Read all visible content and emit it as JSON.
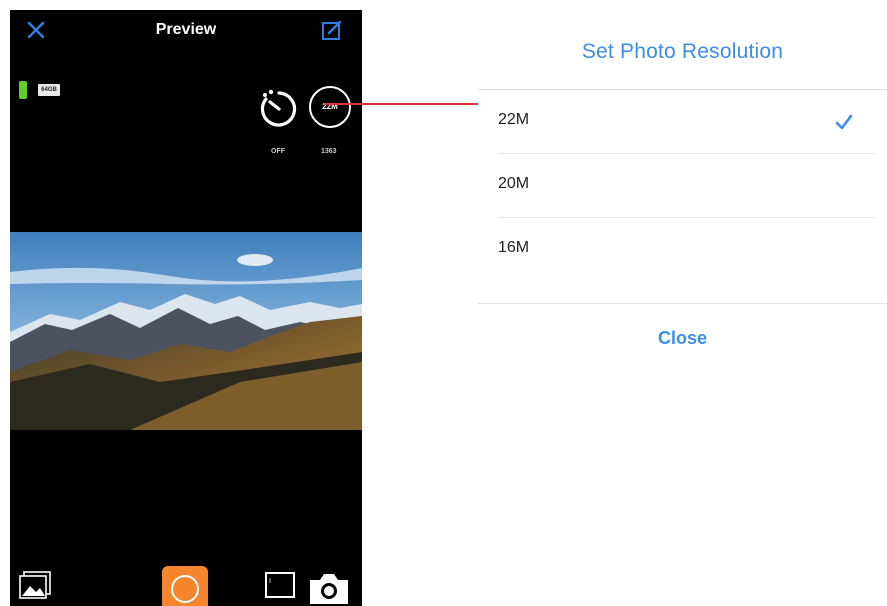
{
  "preview": {
    "title": "Preview",
    "storage_label": "64GB",
    "resolution_badge": "22M",
    "timer_label": "OFF",
    "remaining_count": "1363",
    "video_mode_label": "I"
  },
  "sheet": {
    "title": "Set Photo Resolution",
    "options": [
      {
        "label": "22M",
        "selected": true
      },
      {
        "label": "20M",
        "selected": false
      },
      {
        "label": "16M",
        "selected": false
      }
    ],
    "close_label": "Close"
  },
  "colors": {
    "accent": "#3a8ee6",
    "connector": "#e0343c",
    "shutter": "#f5862d",
    "battery": "#5ecf2d"
  },
  "icons": [
    "close-icon",
    "edit-icon",
    "battery-icon",
    "storage-icon",
    "self-timer-icon",
    "gallery-icon",
    "video-mode-icon",
    "photo-mode-icon",
    "checkmark-icon"
  ]
}
